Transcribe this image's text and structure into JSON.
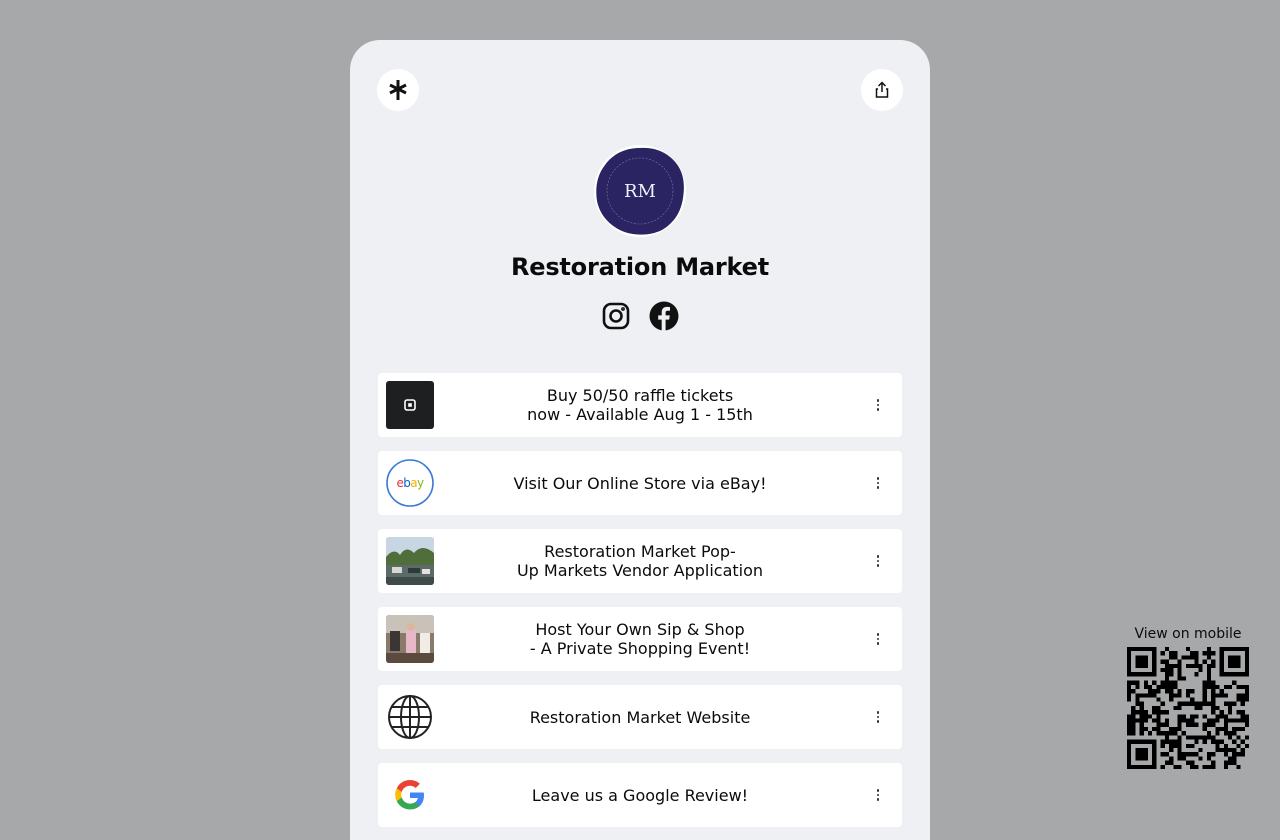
{
  "header": {
    "logo_icon": "linktree-asterisk-icon",
    "share_icon": "share-icon"
  },
  "profile": {
    "name": "Restoration Market",
    "avatar_initials": "RM",
    "avatar_ring_text": "RESTORED THINGS · RESTORING LIVES",
    "brand_color": "#2b2463"
  },
  "socials": [
    {
      "name": "instagram-icon"
    },
    {
      "name": "facebook-icon"
    }
  ],
  "links": [
    {
      "label": "Buy 50/50 raffle tickets\nnow - Available Aug 1 - 15th",
      "thumb": "square-payments-icon"
    },
    {
      "label": "Visit Our Online Store via eBay!",
      "thumb": "ebay-logo",
      "thumb_text": "ebay"
    },
    {
      "label": "Restoration Market Pop-\nUp Markets Vendor Application",
      "thumb": "market-photo"
    },
    {
      "label": "Host Your Own Sip & Shop\n- A Private Shopping Event!",
      "thumb": "event-photo"
    },
    {
      "label": "Restoration Market Website",
      "thumb": "globe-icon"
    },
    {
      "label": "Leave us a Google Review!",
      "thumb": "google-logo"
    }
  ],
  "mobile": {
    "label": "View on mobile",
    "qr_icon": "qr-code-icon"
  }
}
